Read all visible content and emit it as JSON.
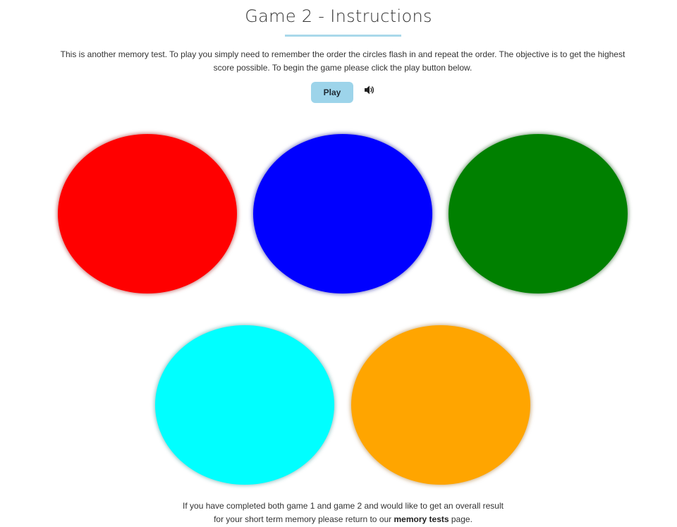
{
  "header": {
    "title": "Game 2 - Instructions"
  },
  "intro": {
    "text": "This is another memory test. To play you simply need to remember the order the circles flash in and repeat the order. The objective is to get the highest score possible. To begin the game please click the play button below."
  },
  "controls": {
    "play_label": "Play",
    "sound_icon": "speaker-volume-icon",
    "accent_color": "#9dd4ea"
  },
  "circles": [
    {
      "name": "red",
      "color": "#ff0000",
      "shadow": "rgba(150,0,0,0.55)"
    },
    {
      "name": "blue",
      "color": "#0000ff",
      "shadow": "rgba(0,0,140,0.55)"
    },
    {
      "name": "green",
      "color": "#008000",
      "shadow": "rgba(0,70,0,0.55)"
    },
    {
      "name": "cyan",
      "color": "#00ffff",
      "shadow": "rgba(0,120,120,0.45)"
    },
    {
      "name": "orange",
      "color": "#ffa500",
      "shadow": "rgba(150,90,0,0.5)"
    }
  ],
  "footer": {
    "text_before_line1": "If you have completed both game 1 and game 2 and would like to get an overall result",
    "text_before_line2": "for your short term memory please return to our ",
    "link_label": "memory tests",
    "text_after": " page."
  }
}
